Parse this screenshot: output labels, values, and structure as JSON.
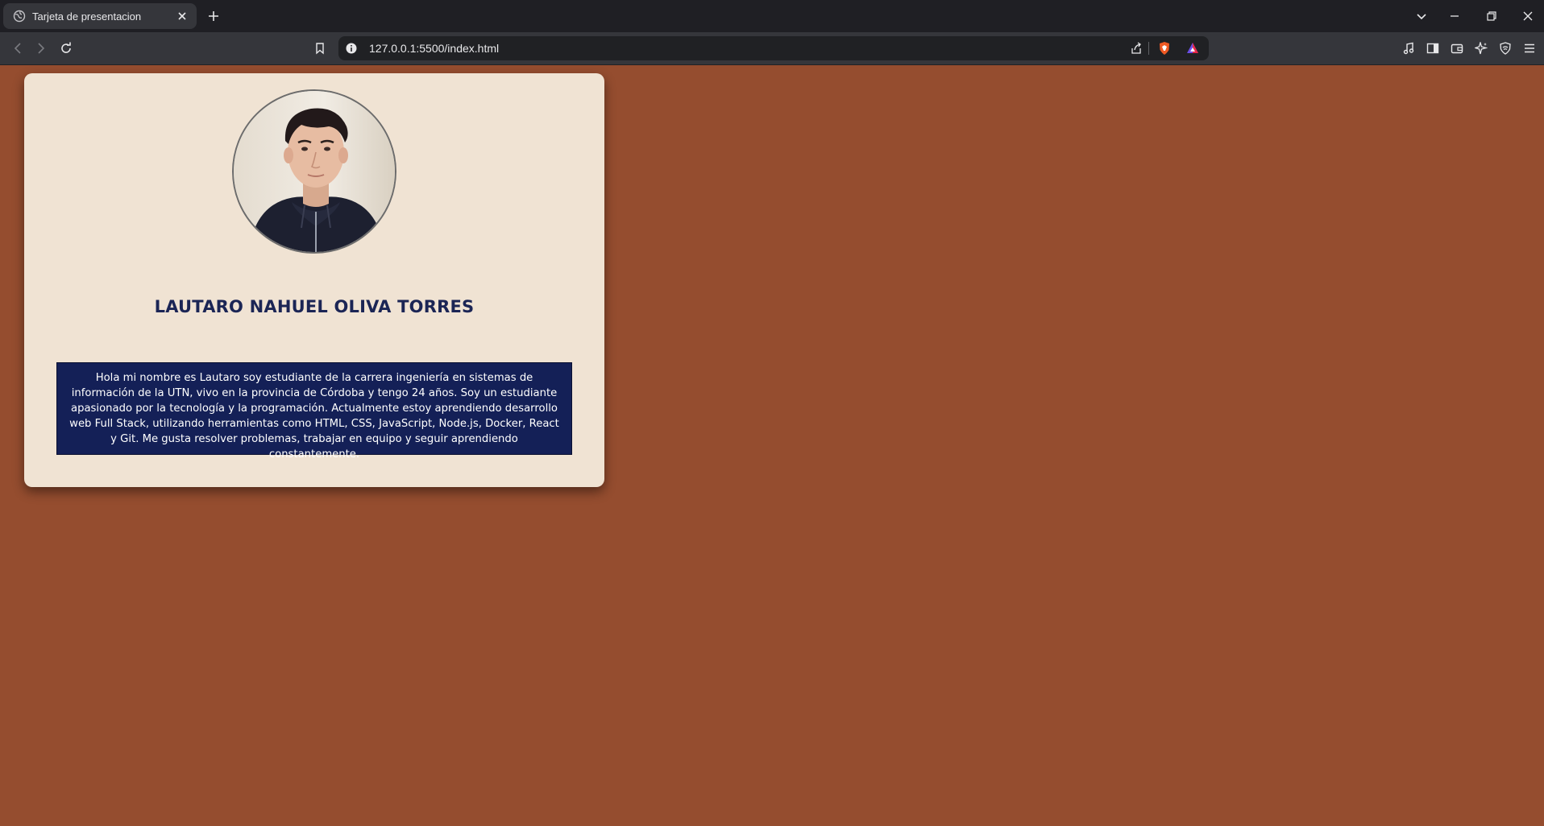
{
  "browser": {
    "tab_title": "Tarjeta de presentacion",
    "url": "127.0.0.1:5500/index.html"
  },
  "profile": {
    "name": "LAUTARO NAHUEL OLIVA TORRES",
    "bio": "Hola mi nombre es Lautaro soy estudiante de la carrera ingeniería en sistemas de información de la UTN, vivo en la provincia de Córdoba y tengo 24 años. Soy un estudiante apasionado por la tecnología y la programación. Actualmente estoy aprendiendo desarrollo web Full Stack, utilizando herramientas como HTML, CSS, JavaScript, Node.js, Docker, React y Git. Me gusta resolver problemas, trabajar en equipo y seguir aprendiendo constantemente."
  },
  "colors": {
    "page_background": "#954d2f",
    "card_background": "#f0e3d3",
    "name_color": "#1b2555",
    "bio_background": "#142057"
  }
}
